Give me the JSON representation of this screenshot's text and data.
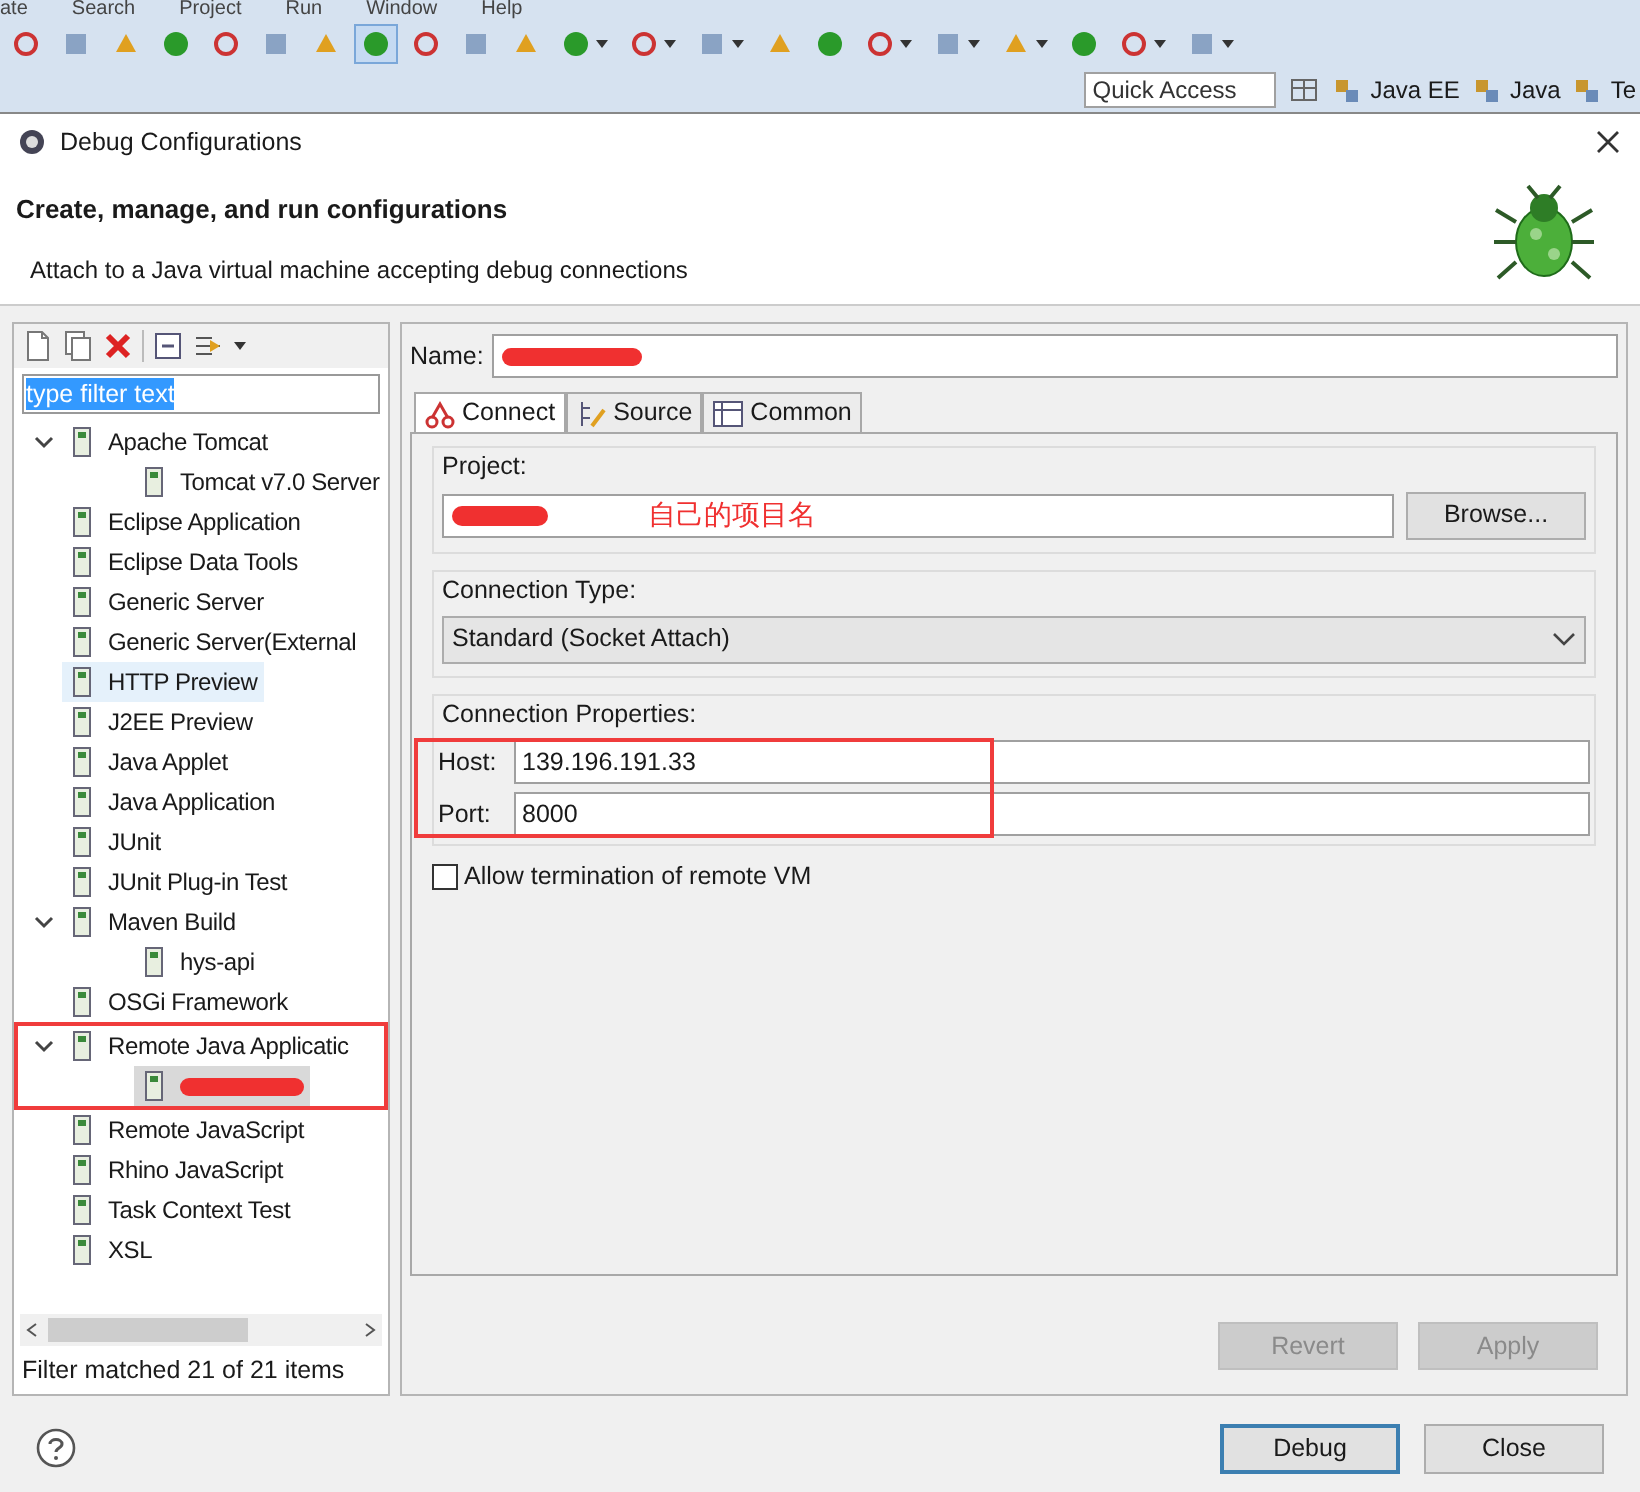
{
  "menu": [
    "ate",
    "Search",
    "Project",
    "Run",
    "Window",
    "Help"
  ],
  "toolbar": [
    {
      "dropdown": false,
      "selected": false
    },
    {
      "dropdown": false,
      "selected": false
    },
    {
      "dropdown": false,
      "selected": false
    },
    {
      "dropdown": false,
      "selected": false
    },
    {
      "dropdown": false,
      "selected": false
    },
    {
      "dropdown": false,
      "selected": false
    },
    {
      "dropdown": false,
      "selected": false
    },
    {
      "dropdown": false,
      "selected": true
    },
    {
      "dropdown": false,
      "selected": false
    },
    {
      "dropdown": false,
      "selected": false
    },
    {
      "dropdown": false,
      "selected": false
    },
    {
      "dropdown": true,
      "selected": false
    },
    {
      "dropdown": true,
      "selected": false
    },
    {
      "dropdown": true,
      "selected": false
    },
    {
      "dropdown": false,
      "selected": false
    },
    {
      "dropdown": false,
      "selected": false
    },
    {
      "dropdown": true,
      "selected": false
    },
    {
      "dropdown": true,
      "selected": false
    },
    {
      "dropdown": true,
      "selected": false
    },
    {
      "dropdown": false,
      "selected": false
    },
    {
      "dropdown": true,
      "selected": false
    },
    {
      "dropdown": true,
      "selected": false
    }
  ],
  "quick_access": {
    "placeholder": "Quick Access"
  },
  "perspectives": [
    "Java EE",
    "Java",
    "Te"
  ],
  "dialog": {
    "title": "Debug Configurations",
    "header_title": "Create, manage, and run configurations",
    "header_message": "Attach to a Java virtual machine accepting debug connections"
  },
  "filter": {
    "value": "type filter text"
  },
  "tree": [
    {
      "label": "Apache Tomcat",
      "expanded": true,
      "selected": false,
      "hover": false,
      "annotated": false,
      "children": [
        {
          "label": "Tomcat v7.0 Server",
          "selected": false,
          "hover": false
        }
      ]
    },
    {
      "label": "Eclipse Application",
      "selected": false,
      "hover": false,
      "annotated": false
    },
    {
      "label": "Eclipse Data Tools",
      "selected": false,
      "hover": false,
      "annotated": false
    },
    {
      "label": "Generic Server",
      "selected": false,
      "hover": false,
      "annotated": false
    },
    {
      "label": "Generic Server(External",
      "selected": false,
      "hover": false,
      "annotated": false
    },
    {
      "label": "HTTP Preview",
      "selected": false,
      "hover": true,
      "annotated": false
    },
    {
      "label": "J2EE Preview",
      "selected": false,
      "hover": false,
      "annotated": false
    },
    {
      "label": "Java Applet",
      "selected": false,
      "hover": false,
      "annotated": false
    },
    {
      "label": "Java Application",
      "selected": false,
      "hover": false,
      "annotated": false
    },
    {
      "label": "JUnit",
      "selected": false,
      "hover": false,
      "annotated": false
    },
    {
      "label": "JUnit Plug-in Test",
      "selected": false,
      "hover": false,
      "annotated": false
    },
    {
      "label": "Maven Build",
      "expanded": true,
      "selected": false,
      "hover": false,
      "annotated": false,
      "children": [
        {
          "label": "hys-api",
          "selected": false,
          "hover": false
        }
      ]
    },
    {
      "label": "OSGi Framework",
      "selected": false,
      "hover": false,
      "annotated": false
    },
    {
      "label": "Remote Java Applicatic",
      "expanded": true,
      "selected": false,
      "hover": false,
      "annotated": true,
      "children": [
        {
          "redacted": true,
          "selected": true,
          "hover": false
        }
      ]
    },
    {
      "label": "Remote JavaScript",
      "selected": false,
      "hover": false,
      "annotated": false
    },
    {
      "label": "Rhino JavaScript",
      "selected": false,
      "hover": false,
      "annotated": false
    },
    {
      "label": "Task Context Test",
      "selected": false,
      "hover": false,
      "annotated": false
    },
    {
      "label": "XSL",
      "selected": false,
      "hover": false,
      "annotated": false
    }
  ],
  "filter_status": "Filter matched 21 of 21 items",
  "name_field": {
    "label": "Name:",
    "redacted": true
  },
  "tabs": [
    {
      "label": "Connect",
      "selected": true
    },
    {
      "label": "Source",
      "selected": false
    },
    {
      "label": "Common",
      "selected": false
    }
  ],
  "project": {
    "label": "Project:",
    "redacted": true,
    "note": "自己的项目名",
    "button": "Browse..."
  },
  "connection_type": {
    "label": "Connection Type:",
    "value": "Standard (Socket Attach)"
  },
  "connection_properties": {
    "label": "Connection Properties:",
    "annotated": true,
    "fields": [
      {
        "label": "Host:",
        "value": "139.196.191.33"
      },
      {
        "label": "Port:",
        "value": "8000"
      }
    ]
  },
  "allow_termination": {
    "label": "Allow termination of remote VM",
    "checked": false
  },
  "buttons": [
    {
      "label": "Revert",
      "disabled": true
    },
    {
      "label": "Apply",
      "disabled": true
    }
  ],
  "footer_buttons": [
    {
      "label": "Debug",
      "default": true
    },
    {
      "label": "Close",
      "default": false
    }
  ]
}
